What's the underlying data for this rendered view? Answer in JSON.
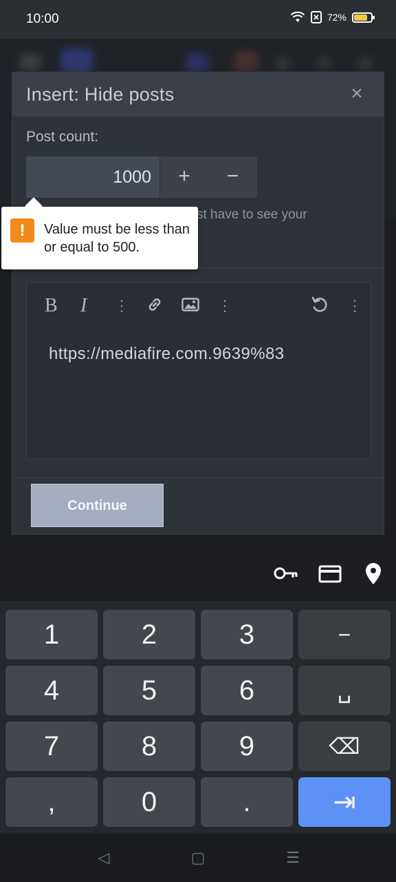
{
  "status_bar": {
    "time": "10:00",
    "battery_percent": "72%",
    "battery_level": 0.72
  },
  "dialog": {
    "title": "Insert: Hide posts",
    "close_icon": "×",
    "post_count_label": "Post count:",
    "post_count_value": "1000",
    "plus_label": "+",
    "minus_label": "−",
    "hint_visible": "st have to see your",
    "editor_content": "https://mediafire.com.9639%83",
    "continue_label": "Continue"
  },
  "tooltip": {
    "icon": "!",
    "message": "Value must be less than or equal to 500."
  },
  "editor_toolbar": {
    "bold": "B",
    "italic": "I",
    "more": "⋮",
    "undo": "↶"
  },
  "keyboard": {
    "rows": [
      [
        "1",
        "2",
        "3",
        "−"
      ],
      [
        "4",
        "5",
        "6",
        "␣"
      ],
      [
        "7",
        "8",
        "9",
        "⌫"
      ],
      [
        ",",
        "0",
        ".",
        "⇥"
      ]
    ]
  },
  "nav": {
    "back": "◁",
    "home": "▢",
    "menu": "☰"
  },
  "colors": {
    "accent": "#5c92f5",
    "warning": "#f28b1b",
    "continue_bg": "#a4adbd"
  }
}
